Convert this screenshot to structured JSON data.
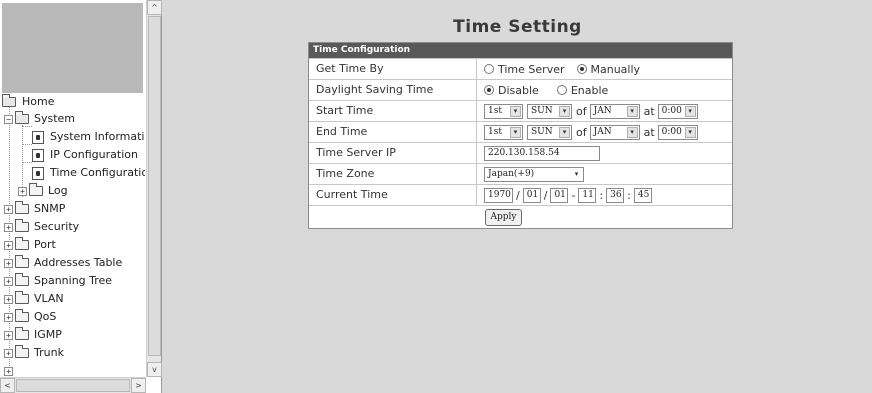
{
  "tree": {
    "items": [
      {
        "label": "Home",
        "kind": "root"
      },
      {
        "label": "System",
        "kind": "folder-open"
      },
      {
        "label": "System Information",
        "kind": "page"
      },
      {
        "label": "IP Configuration",
        "kind": "page"
      },
      {
        "label": "Time Configuration",
        "kind": "page"
      },
      {
        "label": "Log",
        "kind": "folder"
      },
      {
        "label": "SNMP",
        "kind": "folder"
      },
      {
        "label": "Security",
        "kind": "folder"
      },
      {
        "label": "Port",
        "kind": "folder"
      },
      {
        "label": "Addresses Table",
        "kind": "folder"
      },
      {
        "label": "Spanning Tree",
        "kind": "folder"
      },
      {
        "label": "VLAN",
        "kind": "folder"
      },
      {
        "label": "QoS",
        "kind": "folder"
      },
      {
        "label": "IGMP",
        "kind": "folder"
      },
      {
        "label": "Trunk",
        "kind": "folder"
      }
    ],
    "expand_symbol": "+",
    "collapse_symbol": "−"
  },
  "scroll": {
    "up": "^",
    "down": "v",
    "left": "<",
    "right": ">"
  },
  "main": {
    "title": "Time Setting",
    "panel_header": "Time Configuration",
    "rows": {
      "get_time_by": {
        "label": "Get Time By",
        "options": [
          "Time Server",
          "Manually"
        ],
        "selected": "Manually"
      },
      "dst": {
        "label": "Daylight Saving Time",
        "options": [
          "Disable",
          "Enable"
        ],
        "selected": "Disable"
      },
      "start_time": {
        "label": "Start Time",
        "week": "1st",
        "day": "SUN",
        "of": "of",
        "month": "JAN",
        "at": "at",
        "time": "0:00"
      },
      "end_time": {
        "label": "End Time",
        "week": "1st",
        "day": "SUN",
        "of": "of",
        "month": "JAN",
        "at": "at",
        "time": "0:00"
      },
      "time_server_ip": {
        "label": "Time Server IP",
        "value": "220.130.158.54"
      },
      "time_zone": {
        "label": "Time Zone",
        "value": "Japan(+9)"
      },
      "current_time": {
        "label": "Current Time",
        "year": "1970",
        "month": "01",
        "day": "01",
        "hour": "11",
        "minute": "36",
        "second": "45",
        "sep_date": "/",
        "sep_dt": "-",
        "sep_time": ":"
      }
    },
    "apply_label": "Apply",
    "dropdown_arrow": "▾"
  },
  "colors": {
    "panel_header_bg": "#595959",
    "page_bg": "#d9d9d9"
  }
}
